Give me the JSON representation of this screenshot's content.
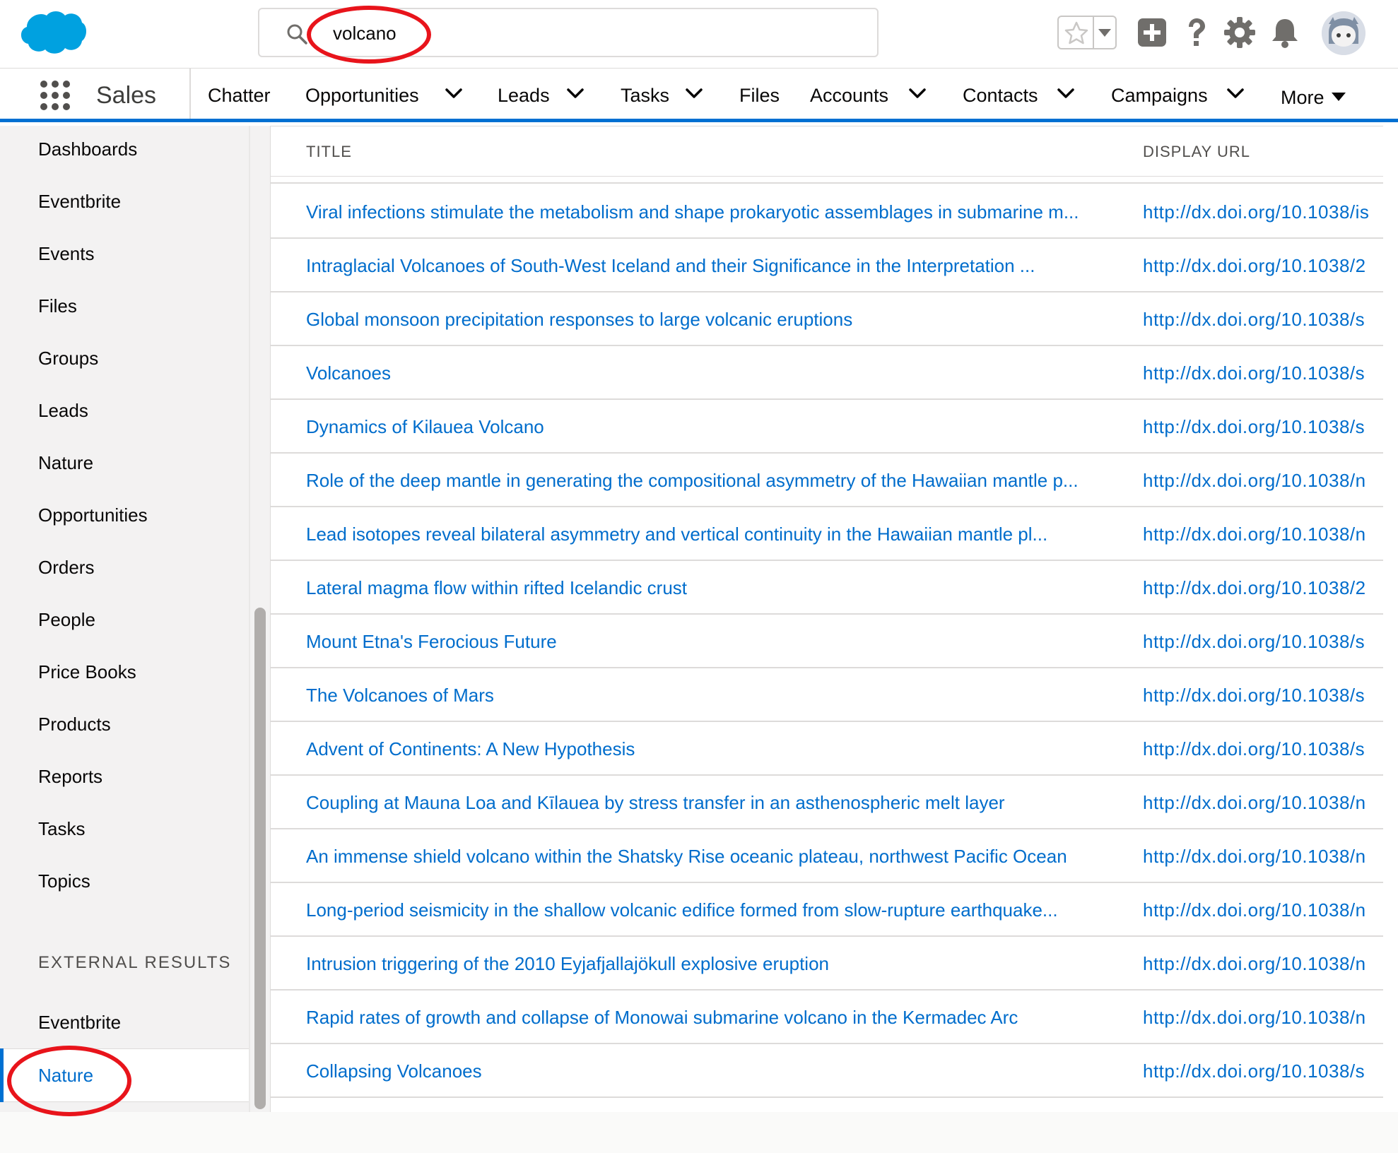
{
  "search": {
    "value": "volcano",
    "placeholder": ""
  },
  "brand": {
    "accent": "#0070d2",
    "link": "#006dcc",
    "annotation": "#e8141b"
  },
  "header": {
    "icons": [
      "salesforce-cloud-logo",
      "search-icon",
      "star-icon",
      "caret-down-icon",
      "add-icon",
      "help-icon",
      "gear-icon",
      "bell-icon",
      "avatar"
    ]
  },
  "nav": {
    "app_name": "Sales",
    "items": [
      {
        "label": "Chatter",
        "has_menu": false
      },
      {
        "label": "Opportunities",
        "has_menu": true
      },
      {
        "label": "Leads",
        "has_menu": true
      },
      {
        "label": "Tasks",
        "has_menu": true
      },
      {
        "label": "Files",
        "has_menu": false
      },
      {
        "label": "Accounts",
        "has_menu": true
      },
      {
        "label": "Contacts",
        "has_menu": true
      },
      {
        "label": "Campaigns",
        "has_menu": true
      }
    ],
    "more_label": "More"
  },
  "sidebar": {
    "items": [
      "Dashboards",
      "Eventbrite",
      "Events",
      "Files",
      "Groups",
      "Leads",
      "Nature",
      "Opportunities",
      "Orders",
      "People",
      "Price Books",
      "Products",
      "Reports",
      "Tasks",
      "Topics"
    ],
    "external_heading": "EXTERNAL RESULTS",
    "external_items": [
      "Eventbrite",
      "Nature"
    ],
    "active": "Nature"
  },
  "table": {
    "columns": [
      "TITLE",
      "DISPLAY URL"
    ],
    "rows": [
      {
        "title": "Viral infections stimulate the metabolism and shape prokaryotic assemblages in submarine m...",
        "url": "http://dx.doi.org/10.1038/is"
      },
      {
        "title": "Intraglacial Volcanoes of South-West Iceland and their Significance in the Interpretation ...",
        "url": "http://dx.doi.org/10.1038/2"
      },
      {
        "title": "Global monsoon precipitation responses to large volcanic eruptions",
        "url": "http://dx.doi.org/10.1038/s"
      },
      {
        "title": "Volcanoes",
        "url": "http://dx.doi.org/10.1038/s"
      },
      {
        "title": "Dynamics of Kilauea Volcano",
        "url": "http://dx.doi.org/10.1038/s"
      },
      {
        "title": "Role of the deep mantle in generating the compositional asymmetry of the Hawaiian mantle p...",
        "url": "http://dx.doi.org/10.1038/n"
      },
      {
        "title": "Lead isotopes reveal bilateral asymmetry and vertical continuity in the Hawaiian mantle pl...",
        "url": "http://dx.doi.org/10.1038/n"
      },
      {
        "title": "Lateral magma flow within rifted Icelandic crust",
        "url": "http://dx.doi.org/10.1038/2"
      },
      {
        "title": "Mount Etna's Ferocious Future",
        "url": "http://dx.doi.org/10.1038/s"
      },
      {
        "title": "The Volcanoes of Mars",
        "url": "http://dx.doi.org/10.1038/s"
      },
      {
        "title": "Advent of Continents: A New Hypothesis",
        "url": "http://dx.doi.org/10.1038/s"
      },
      {
        "title": "Coupling at Mauna Loa and Kīlauea by stress transfer in an asthenospheric melt layer",
        "url": "http://dx.doi.org/10.1038/n"
      },
      {
        "title": "An immense shield volcano within the Shatsky Rise oceanic plateau, northwest Pacific Ocean",
        "url": "http://dx.doi.org/10.1038/n"
      },
      {
        "title": "Long-period seismicity in the shallow volcanic edifice formed from slow-rupture earthquake...",
        "url": "http://dx.doi.org/10.1038/n"
      },
      {
        "title": "Intrusion triggering of the 2010 Eyjafjallajökull explosive eruption",
        "url": "http://dx.doi.org/10.1038/n"
      },
      {
        "title": "Rapid rates of growth and collapse of Monowai submarine volcano in the Kermadec Arc",
        "url": "http://dx.doi.org/10.1038/n"
      },
      {
        "title": "Collapsing Volcanoes",
        "url": "http://dx.doi.org/10.1038/s"
      }
    ]
  }
}
